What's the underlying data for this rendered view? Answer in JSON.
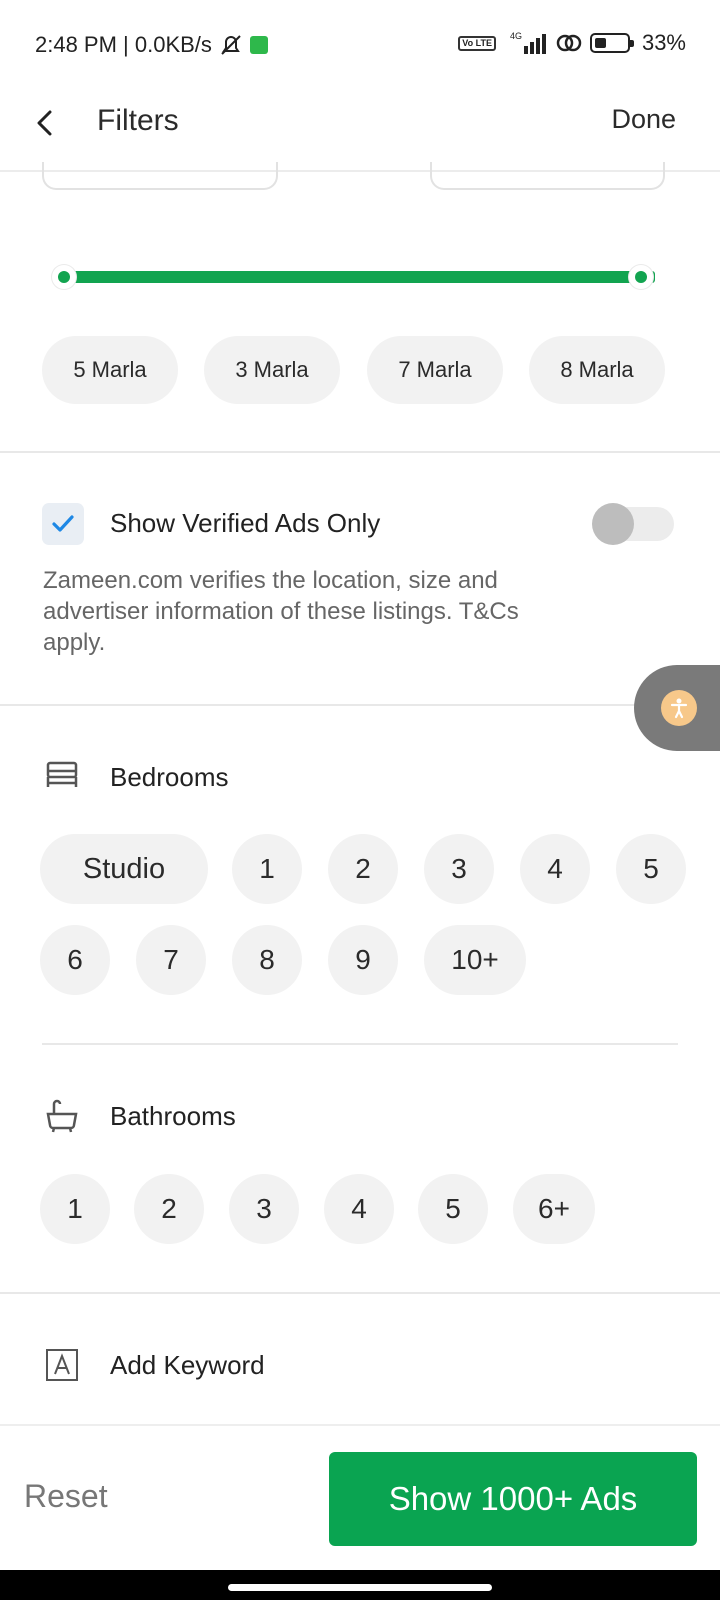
{
  "status": {
    "time_speed": "2:48 PM | 0.0KB/s",
    "network": "4G",
    "volte": "Vo LTE",
    "battery": "33%"
  },
  "header": {
    "title": "Filters",
    "done_label": "Done"
  },
  "area": {
    "size_chips": [
      "5 Marla",
      "3 Marla",
      "7 Marla",
      "8 Marla"
    ]
  },
  "verified": {
    "title": "Show Verified Ads Only",
    "description": "Zameen.com verifies the location, size and advertiser information of these listings. T&Cs apply.",
    "checked": true,
    "toggle_on": false
  },
  "bedrooms": {
    "title": "Bedrooms",
    "options": [
      "Studio",
      "1",
      "2",
      "3",
      "4",
      "5",
      "6",
      "7",
      "8",
      "9",
      "10+"
    ]
  },
  "bathrooms": {
    "title": "Bathrooms",
    "options": [
      "1",
      "2",
      "3",
      "4",
      "5",
      "6+"
    ]
  },
  "keyword": {
    "title": "Add Keyword"
  },
  "footer": {
    "reset_label": "Reset",
    "show_label": "Show 1000+ Ads"
  },
  "colors": {
    "accent_green": "#0aa451",
    "chip_bg": "#f2f2f2"
  }
}
